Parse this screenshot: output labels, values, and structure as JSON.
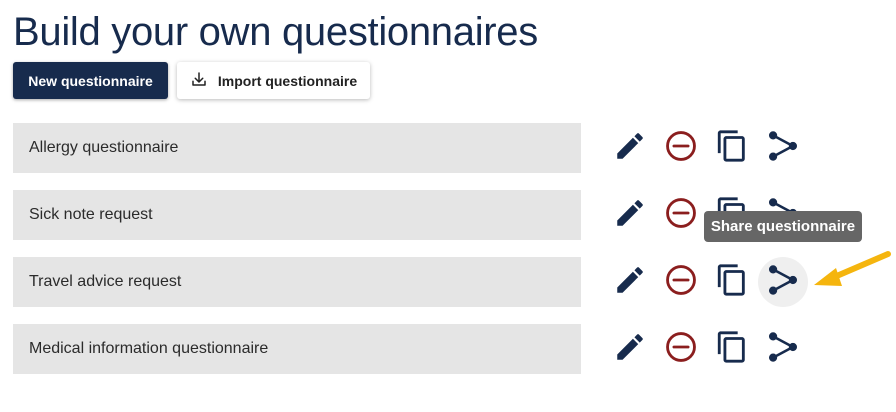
{
  "page": {
    "title": "Build your own questionnaires"
  },
  "toolbar": {
    "new_label": "New questionnaire",
    "import_label": "Import questionnaire"
  },
  "questionnaires": [
    {
      "name": "Allergy questionnaire"
    },
    {
      "name": "Sick note request"
    },
    {
      "name": "Travel advice request"
    },
    {
      "name": "Medical information questionnaire"
    }
  ],
  "tooltip": {
    "text": "Share questionnaire"
  },
  "colors": {
    "primary": "#172b4d",
    "delete": "#8b1e1e",
    "row_bg": "#e5e5e5",
    "tooltip_bg": "#666666",
    "annotation_arrow": "#f5b50e"
  },
  "icons": {
    "edit": "pencil-icon",
    "delete": "minus-circle-icon",
    "copy": "copy-icon",
    "share": "share-icon",
    "import": "download-icon"
  }
}
